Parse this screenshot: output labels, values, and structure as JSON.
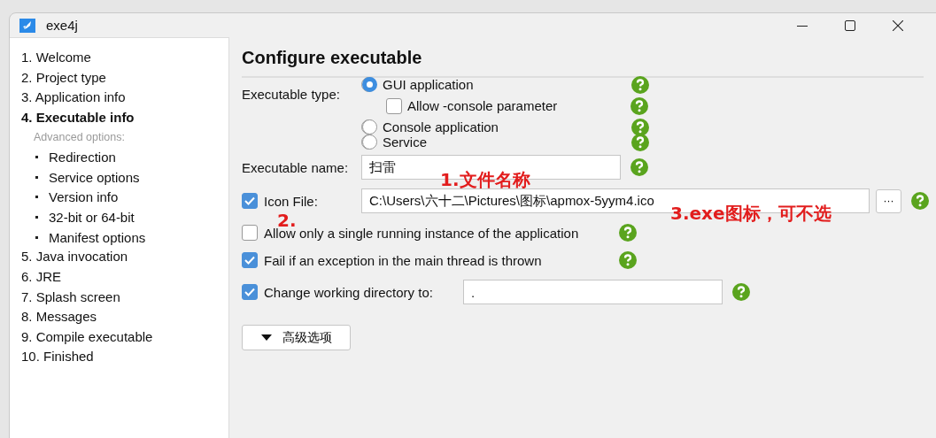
{
  "window": {
    "title": "exe4j"
  },
  "sidebar": {
    "steps": [
      {
        "label": "1. Welcome",
        "selected": false
      },
      {
        "label": "2. Project type",
        "selected": false
      },
      {
        "label": "3. Application info",
        "selected": false
      },
      {
        "label": "4. Executable info",
        "selected": true,
        "advanced": {
          "heading": "Advanced options:",
          "items": [
            "Redirection",
            "Service options",
            "Version info",
            "32-bit or 64-bit",
            "Manifest options"
          ]
        }
      },
      {
        "label": "5. Java invocation",
        "selected": false
      },
      {
        "label": "6. JRE",
        "selected": false
      },
      {
        "label": "7. Splash screen",
        "selected": false
      },
      {
        "label": "8. Messages",
        "selected": false
      },
      {
        "label": "9. Compile executable",
        "selected": false
      },
      {
        "label": "10. Finished",
        "selected": false
      }
    ]
  },
  "page": {
    "title": "Configure executable",
    "executable_type": {
      "label": "Executable type:",
      "options": [
        {
          "kind": "radio",
          "label": "GUI application",
          "selected": true
        },
        {
          "kind": "checkbox",
          "label": "Allow -console parameter",
          "checked": false
        },
        {
          "kind": "radio",
          "label": "Console application",
          "selected": false
        },
        {
          "kind": "radio",
          "label": "Service",
          "selected": false
        }
      ]
    },
    "executable_name": {
      "label": "Executable name:",
      "value": "扫雷"
    },
    "icon_file": {
      "label": "Icon File:",
      "checked": true,
      "value": "C:\\Users\\六十二\\Pictures\\图标\\apmox-5yym4.ico",
      "browse": "···"
    },
    "options": [
      {
        "label": "Allow only a single running instance of the application",
        "checked": false
      },
      {
        "label": "Fail if an exception in the main thread is thrown",
        "checked": true
      }
    ],
    "working_directory": {
      "label": "Change working directory to:",
      "checked": true,
      "value": "."
    },
    "advanced_button": "高级选项"
  },
  "annotations": [
    "1.文件名称",
    "2.",
    "3.exe图标，可不选"
  ]
}
